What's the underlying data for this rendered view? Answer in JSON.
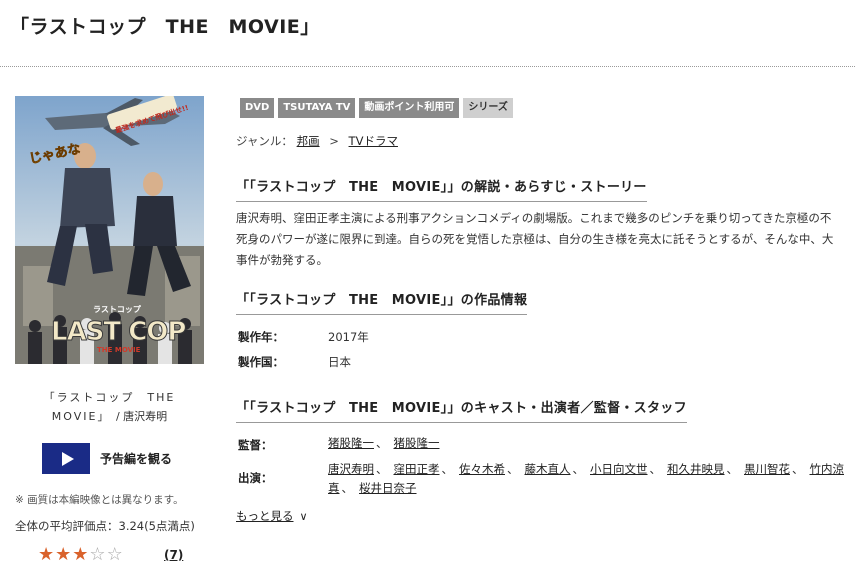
{
  "page": {
    "title": "「ラストコップ　THE　MOVIE」"
  },
  "poster": {
    "image_text_main": "LAST COP",
    "image_text_small": "ラストコップ",
    "image_text_sub": "THE MOVIE",
    "image_text_speech": "じゃあな",
    "image_text_banner": "最強を求めて飛び出せ!!",
    "caption_title": "「ラストコップ　THE　MOVIE」",
    "caption_artist": "/ 唐沢寿明"
  },
  "trailer": {
    "label": "予告編を観る"
  },
  "notes": {
    "quality": "※ 画質は本編映像とは異なります。"
  },
  "rating": {
    "text": "全体の平均評価点：3.24(5点満点)",
    "score": 3.24,
    "max": 5,
    "filled_stars": 3,
    "review_count": "(7)",
    "star_color": "#d9622b"
  },
  "tags": [
    "DVD",
    "TSUTAYA TV",
    "動画ポイント利用可",
    "シリーズ"
  ],
  "genre": {
    "label": "ジャンル：",
    "items": [
      "邦画",
      "TVドラマ"
    ],
    "separator": ">"
  },
  "sections": {
    "synopsis_heading": "「「ラストコップ　THE　MOVIE」」の解説・あらすじ・ストーリー",
    "synopsis": "唐沢寿明、窪田正孝主演による刑事アクションコメディの劇場版。これまで幾多のピンチを乗り切ってきた京極の不死身のパワーが遂に限界に到達。自らの死を覚悟した京極は、自分の生き様を亮太に託そうとするが、そんな中、大事件が勃発する。",
    "info_heading": "「「ラストコップ　THE　MOVIE」」の作品情報",
    "cast_heading": "「「ラストコップ　THE　MOVIE」」のキャスト・出演者／監督・スタッフ"
  },
  "info": {
    "year_label": "製作年：",
    "year_value": "2017年",
    "country_label": "製作国：",
    "country_value": "日本"
  },
  "staff": {
    "director_label": "監督：",
    "directors": [
      "猪股隆一",
      "猪股隆一"
    ],
    "cast_label": "出演：",
    "cast": [
      "唐沢寿明",
      "窪田正孝",
      "佐々木希",
      "藤木直人",
      "小日向文世",
      "和久井映見",
      "黒川智花",
      "竹内涼真",
      "桜井日奈子"
    ]
  },
  "more": {
    "label": "もっと見る"
  }
}
